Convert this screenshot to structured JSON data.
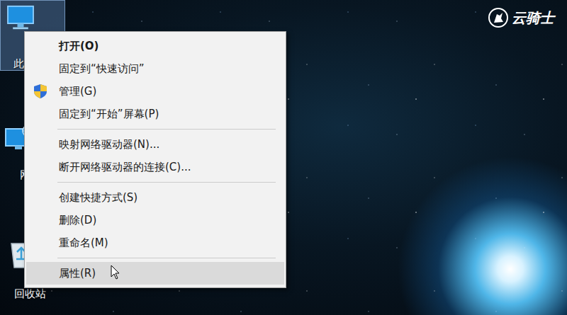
{
  "desktop_icons": [
    {
      "label": "此",
      "selected": true
    },
    {
      "label": "网",
      "selected": false
    },
    {
      "label": "回收站",
      "selected": false
    }
  ],
  "watermark": {
    "text": "云骑士"
  },
  "context_menu": {
    "items": [
      {
        "kind": "item",
        "label": "打开(O)",
        "default": true,
        "selected": false
      },
      {
        "kind": "item",
        "label": "固定到“快速访问”",
        "default": false,
        "selected": false
      },
      {
        "kind": "admin",
        "label": "管理(G)",
        "default": false,
        "selected": false
      },
      {
        "kind": "item",
        "label": "固定到“开始”屏幕(P)",
        "default": false,
        "selected": false
      },
      {
        "kind": "separator",
        "label": "",
        "default": false,
        "selected": false
      },
      {
        "kind": "item",
        "label": "映射网络驱动器(N)...",
        "default": false,
        "selected": false
      },
      {
        "kind": "item",
        "label": "断开网络驱动器的连接(C)...",
        "default": false,
        "selected": false
      },
      {
        "kind": "separator",
        "label": "",
        "default": false,
        "selected": false
      },
      {
        "kind": "item",
        "label": "创建快捷方式(S)",
        "default": false,
        "selected": false
      },
      {
        "kind": "item",
        "label": "删除(D)",
        "default": false,
        "selected": false
      },
      {
        "kind": "item",
        "label": "重命名(M)",
        "default": false,
        "selected": false
      },
      {
        "kind": "separator",
        "label": "",
        "default": false,
        "selected": false
      },
      {
        "kind": "item",
        "label": "属性(R)",
        "default": false,
        "selected": true
      }
    ]
  }
}
